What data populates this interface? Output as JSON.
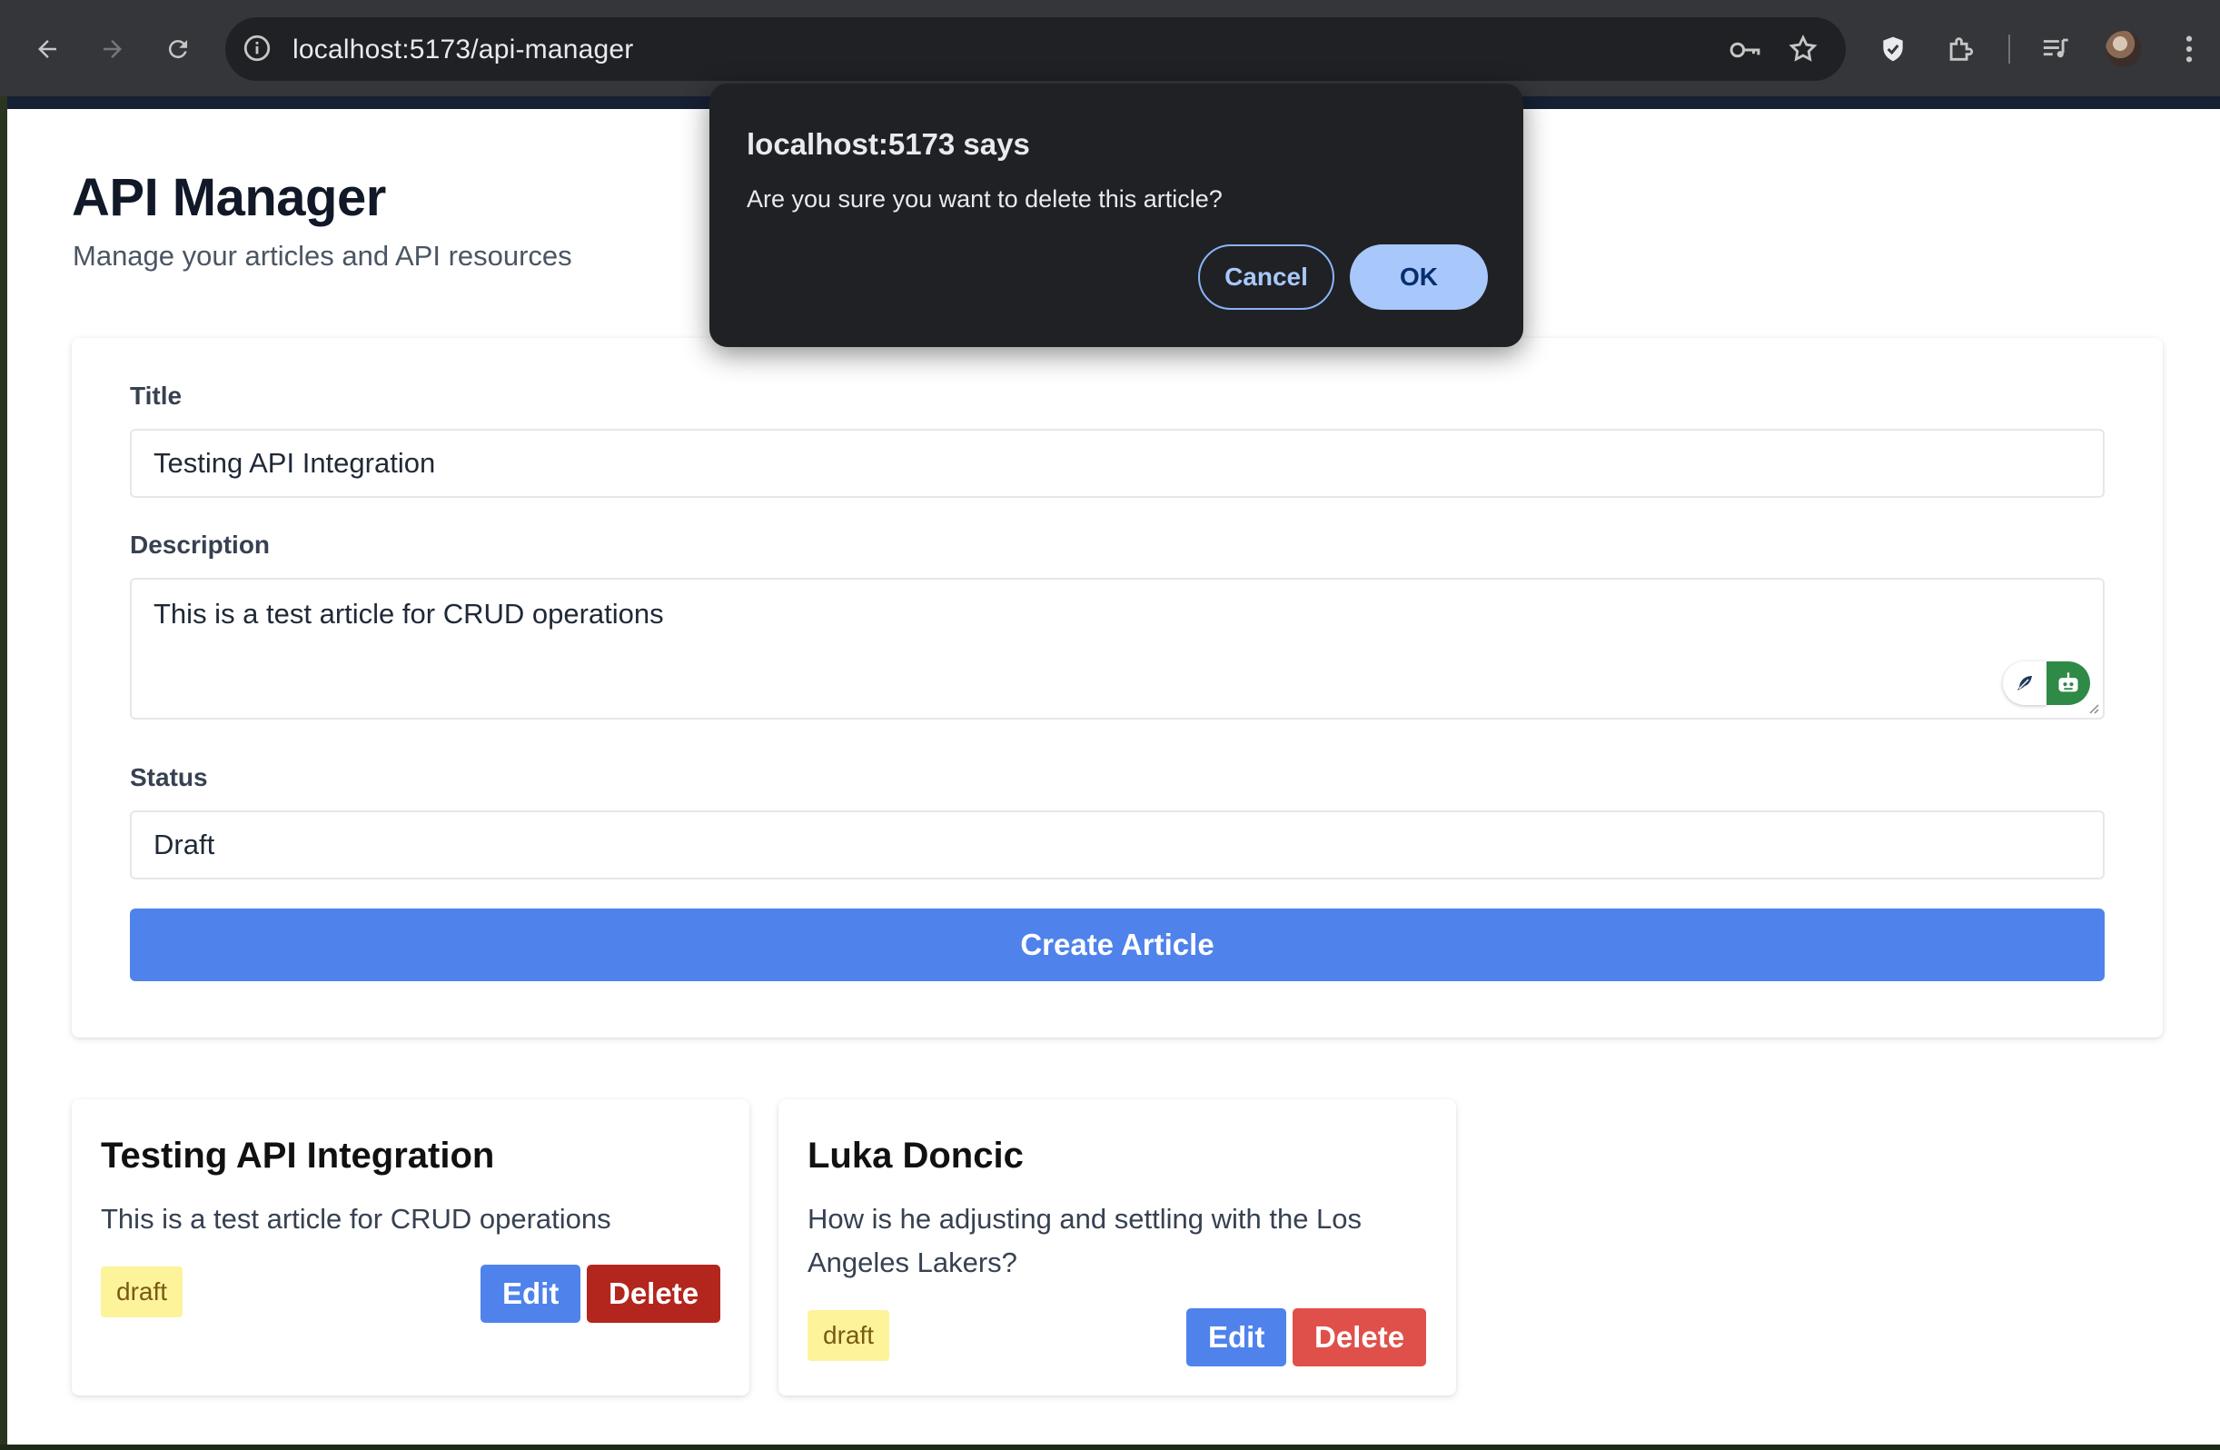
{
  "browser": {
    "url": "localhost:5173/api-manager"
  },
  "page": {
    "title": "API Manager",
    "subtitle": "Manage your articles and API resources"
  },
  "form": {
    "title_label": "Title",
    "title_value": "Testing API Integration",
    "description_label": "Description",
    "description_value": "This is a test article for CRUD operations",
    "status_label": "Status",
    "status_value": "Draft",
    "submit_label": "Create Article"
  },
  "articles": [
    {
      "title": "Testing API Integration",
      "description": "This is a test article for CRUD operations",
      "status": "draft",
      "edit_label": "Edit",
      "delete_label": "Delete"
    },
    {
      "title": "Luka Doncic",
      "description": "How is he adjusting and settling with the Los Angeles Lakers?",
      "status": "draft",
      "edit_label": "Edit",
      "delete_label": "Delete"
    }
  ],
  "dialog": {
    "title": "localhost:5173 says",
    "message": "Are you sure you want to delete this article?",
    "cancel_label": "Cancel",
    "ok_label": "OK"
  },
  "colors": {
    "primary_button": "#4f83eb",
    "delete_button": "#b3261e",
    "status_badge": "#fdf39b"
  }
}
